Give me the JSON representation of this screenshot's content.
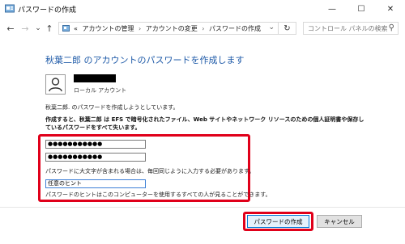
{
  "window": {
    "title": "パスワードの作成",
    "controls": {
      "minimize": "—",
      "maximize": "☐",
      "close": "✕"
    }
  },
  "nav": {
    "back": "←",
    "forward": "→",
    "dropdown": "⌄",
    "up": "↑",
    "breadcrumb_prefix": "«",
    "breadcrumbs": [
      "アカウントの管理",
      "アカウントの変更",
      "パスワードの作成"
    ],
    "breadcrumb_separator": "›",
    "refresh": "↻",
    "search_placeholder": "コントロール パネルの検索",
    "search_icon": "⚲"
  },
  "content": {
    "heading": "秋葉二郎 のアカウントのパスワードを作成します",
    "account_type": "ローカル アカウント",
    "intro": "秋葉二郎. のパスワードを作成しようとしています。",
    "warning": "作成すると、秋葉二郎 は EFS で暗号化されたファイル、Web サイトやネットワーク リソースのための個人証明書や保存しているパスワードをすべて失います。",
    "password": "●●●●●●●●●●●",
    "password_confirm": "●●●●●●●●●●●",
    "note_case": "パスワードに大文字が含まれる場合は、毎回同じように入力する必要があります。",
    "hint_value": "任意のヒント",
    "note_hint": "パスワードのヒントはこのコンピューターを使用するすべての人が見ることができます。"
  },
  "buttons": {
    "create": "パスワードの作成",
    "cancel": "キャンセル"
  },
  "colors": {
    "heading": "#1e5aa8",
    "highlight": "#e0001a",
    "primary_button_border": "#0078d7"
  }
}
